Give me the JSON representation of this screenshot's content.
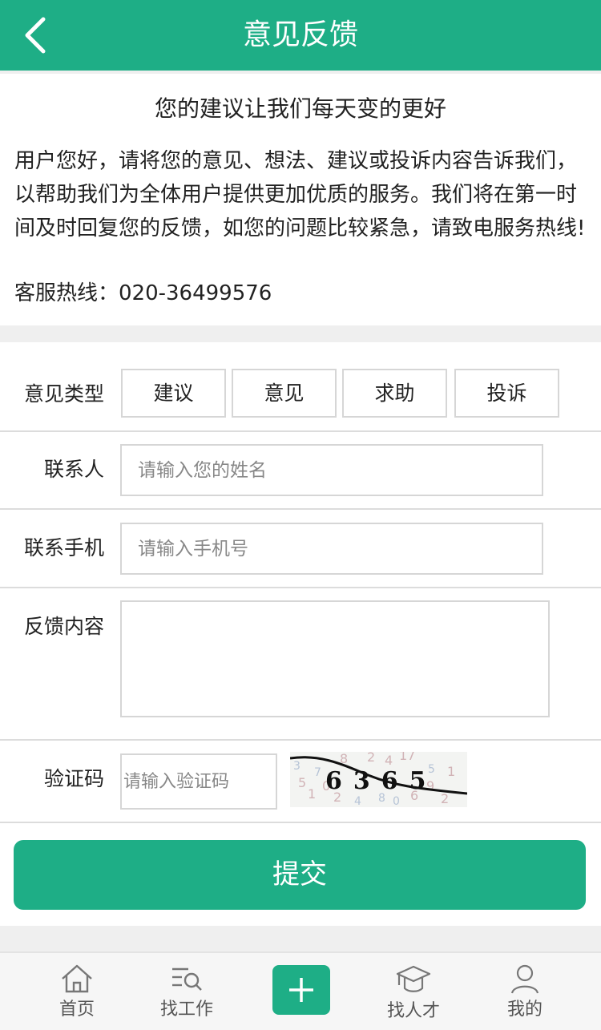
{
  "header": {
    "title": "意见反馈"
  },
  "intro": {
    "slogan": "您的建议让我们每天变的更好",
    "description": "用户您好，请将您的意见、想法、建议或投诉内容告诉我们，以帮助我们为全体用户提供更加优质的服务。我们将在第一时间及时回复您的反馈，如您的问题比较紧急，请致电服务热线!",
    "hotline": "客服热线：020-36499576"
  },
  "form": {
    "type_label": "意见类型",
    "types": [
      "建议",
      "意见",
      "求助",
      "投诉"
    ],
    "contact_label": "联系人",
    "contact_placeholder": "请输入您的姓名",
    "phone_label": "联系手机",
    "phone_placeholder": "请输入手机号",
    "content_label": "反馈内容",
    "content_value": "",
    "captcha_label": "验证码",
    "captcha_placeholder": "请输入验证码",
    "captcha_text": "6365",
    "submit_label": "提交"
  },
  "tabbar": {
    "items": [
      {
        "label": "首页",
        "icon": "home-icon"
      },
      {
        "label": "找工作",
        "icon": "job-search-icon"
      },
      {
        "label": "",
        "icon": "plus-icon"
      },
      {
        "label": "找人才",
        "icon": "graduation-cap-icon"
      },
      {
        "label": "我的",
        "icon": "user-icon"
      }
    ]
  },
  "colors": {
    "brand": "#1eae86",
    "background": "#efefef",
    "border": "#d6d6d6"
  }
}
